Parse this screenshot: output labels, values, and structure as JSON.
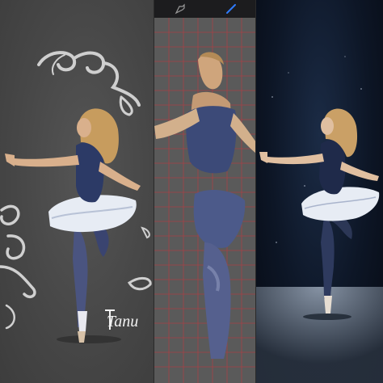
{
  "panels": {
    "left": {
      "name": "painted-sketch-panel"
    },
    "middle": {
      "name": "procreate-canvas-panel"
    },
    "right": {
      "name": "reference-photo-panel"
    }
  },
  "toolbar": {
    "tools": [
      "pen-nib-icon",
      "brush-icon"
    ],
    "accent": "#2f7bff"
  },
  "signature": {
    "text": "Tanu"
  },
  "colors": {
    "gray_bg": "#4a4a4a",
    "grid_line": "#c0393f",
    "photo_bg": "#0d1626",
    "tutu": "#e7ecf4",
    "leotard": "#2c3a66",
    "skin": "#d9b08c",
    "hair": "#c79c5e"
  }
}
